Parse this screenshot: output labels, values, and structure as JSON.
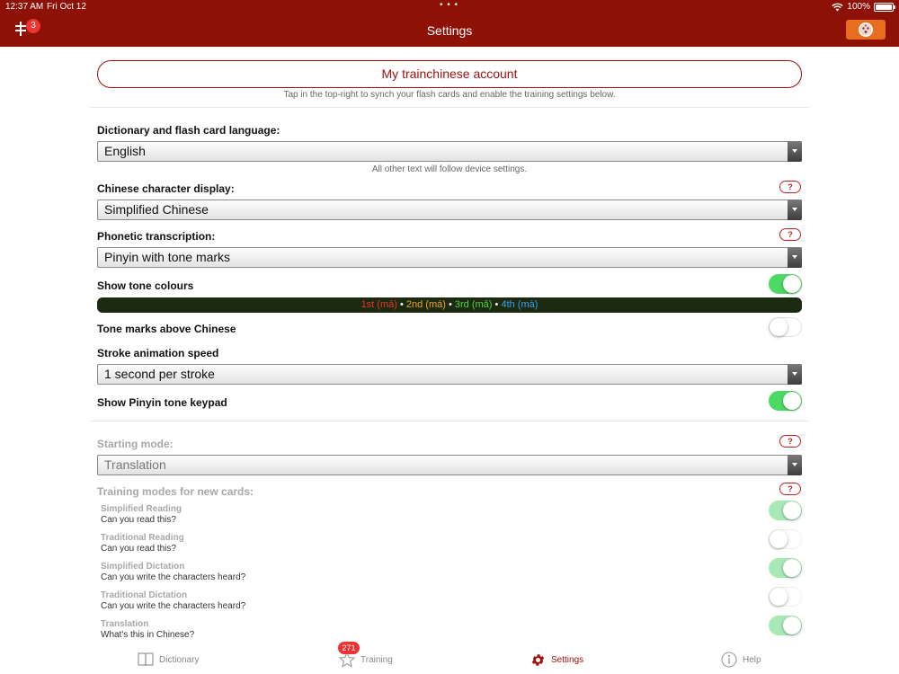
{
  "status_bar": {
    "time": "12:37 AM",
    "date": "Fri Oct 12",
    "battery": "100%",
    "ellipsis": "• • •"
  },
  "header": {
    "title": "Settings",
    "sync_badge": "3"
  },
  "account": {
    "button_label": "My trainchinese account",
    "hint": "Tap in the top-right to synch your flash cards and enable the training settings below."
  },
  "dictionary_language": {
    "label": "Dictionary and flash card language:",
    "value": "English",
    "hint": "All other text will follow device settings."
  },
  "character_display": {
    "label": "Chinese character display:",
    "value": "Simplified Chinese",
    "help": "?"
  },
  "phonetic": {
    "label": "Phonetic transcription:",
    "value": "Pinyin with tone marks",
    "help": "?"
  },
  "tone_colours": {
    "label": "Show tone colours",
    "on": true,
    "sep": "•",
    "tones": [
      {
        "text": "1st (mā)",
        "color": "#e8342e"
      },
      {
        "text": "2nd (má)",
        "color": "#f2a11e"
      },
      {
        "text": "3rd (mǎ)",
        "color": "#4ed040"
      },
      {
        "text": "4th (mà)",
        "color": "#3b9ff0"
      }
    ]
  },
  "tone_marks_above": {
    "label": "Tone marks above Chinese",
    "on": false
  },
  "stroke_speed": {
    "label": "Stroke animation speed",
    "value": "1 second per stroke"
  },
  "pinyin_keypad": {
    "label": "Show Pinyin tone keypad",
    "on": true
  },
  "starting_mode": {
    "label": "Starting mode:",
    "value": "Translation",
    "help": "?"
  },
  "training_modes": {
    "label": "Training modes for new cards:",
    "help": "?",
    "items": [
      {
        "title": "Simplified Reading",
        "subtitle": "Can you read this?",
        "on": true
      },
      {
        "title": "Traditional Reading",
        "subtitle": "Can you read this?",
        "on": false
      },
      {
        "title": "Simplified Dictation",
        "subtitle": "Can you write the characters heard?",
        "on": true
      },
      {
        "title": "Traditional Dictation",
        "subtitle": "Can you write the characters heard?",
        "on": false
      },
      {
        "title": "Translation",
        "subtitle": "What's this in Chinese?",
        "on": true
      }
    ]
  },
  "tabbar": {
    "dictionary": "Dictionary",
    "training": "Training",
    "training_badge": "271",
    "settings": "Settings",
    "help": "Help"
  },
  "colors": {
    "header_bg": "#8e1106",
    "accent": "#a01010",
    "toggle_on": "#4cd964",
    "avatar_btn": "#e96d1f"
  }
}
